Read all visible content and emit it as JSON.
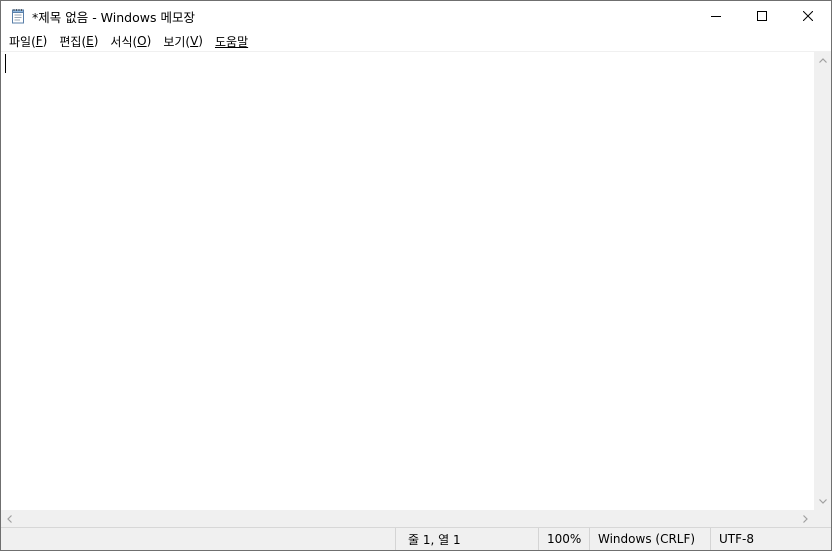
{
  "window": {
    "title": "*제목 없음 - Windows 메모장",
    "app_icon": "notepad-icon",
    "controls": {
      "minimize": "minimize-icon",
      "maximize": "maximize-icon",
      "close": "close-icon"
    }
  },
  "menu": {
    "file": {
      "label": "파일(",
      "key": "F",
      "end": ")"
    },
    "edit": {
      "label": "편집(",
      "key": "E",
      "end": ")"
    },
    "format": {
      "label": "서식(",
      "key": "O",
      "end": ")"
    },
    "view": {
      "label": "보기(",
      "key": "V",
      "end": ")"
    },
    "help": {
      "label": "",
      "key": "도움말",
      "end": ""
    }
  },
  "editor": {
    "content": ""
  },
  "status": {
    "position": "줄 1, 열 1",
    "zoom": "100%",
    "line_ending": "Windows (CRLF)",
    "encoding": "UTF-8"
  },
  "colors": {
    "chrome": "#f0f0f0",
    "scroll_arrow": "#a0a0a0",
    "border": "#6f6f6f"
  }
}
